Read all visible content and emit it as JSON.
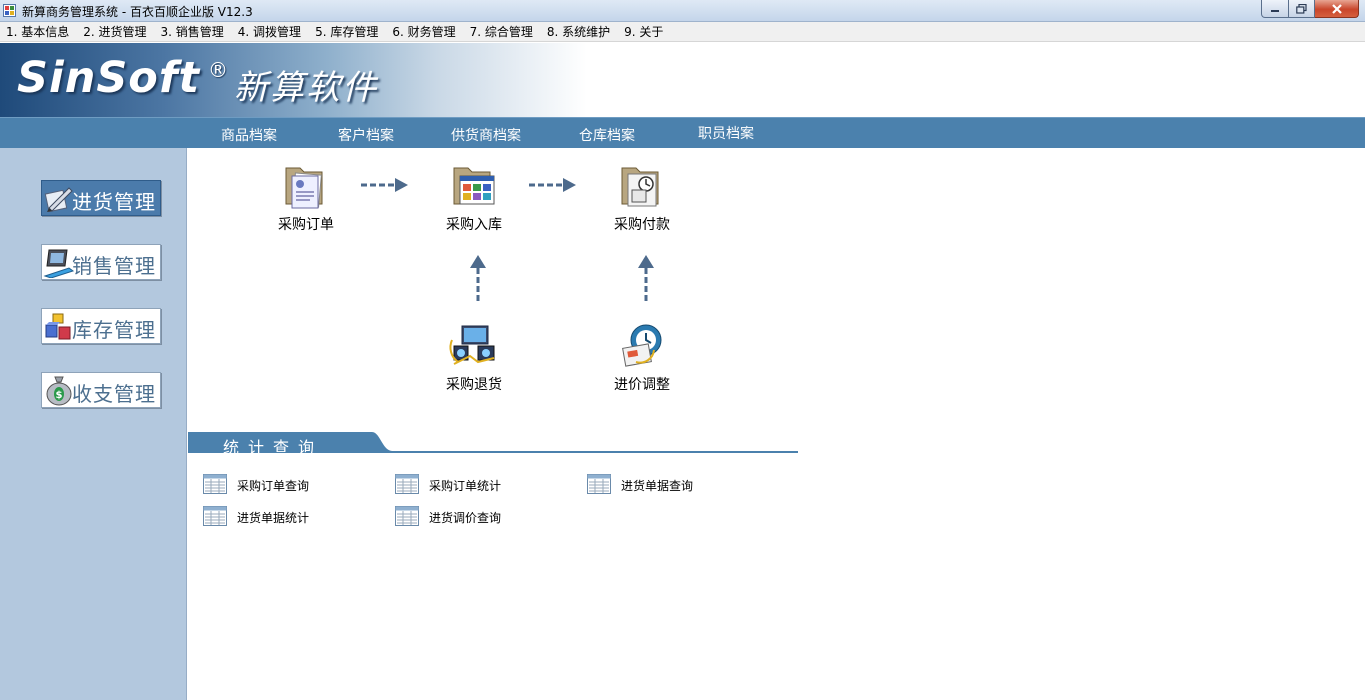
{
  "window": {
    "title": "新算商务管理系统 - 百衣百顺企业版 V12.3"
  },
  "menu": [
    "1. 基本信息",
    "2. 进货管理",
    "3. 销售管理",
    "4. 调拨管理",
    "5. 库存管理",
    "6. 财务管理",
    "7. 综合管理",
    "8. 系统维护",
    "9. 关于"
  ],
  "banner": {
    "logo_text": "SinSoft",
    "logo_reg": "®",
    "logo_cn": "新算软件"
  },
  "nav": [
    "商品档案",
    "客户档案",
    "供货商档案",
    "仓库档案",
    "职员档案"
  ],
  "sidebar": [
    {
      "label": "进货管理",
      "icon": "pen-paper-icon",
      "active": true
    },
    {
      "label": "销售管理",
      "icon": "computer-icon",
      "active": false
    },
    {
      "label": "库存管理",
      "icon": "boxes-icon",
      "active": false
    },
    {
      "label": "收支管理",
      "icon": "money-bag-icon",
      "active": false
    }
  ],
  "flow": {
    "order": {
      "label": "采购订单",
      "icon": "order-folder-icon"
    },
    "inbound": {
      "label": "采购入库",
      "icon": "inbound-folder-icon"
    },
    "payment": {
      "label": "采购付款",
      "icon": "payment-folder-icon"
    },
    "return": {
      "label": "采购退货",
      "icon": "return-icon"
    },
    "price_adjust": {
      "label": "进价调整",
      "icon": "price-adjust-icon"
    }
  },
  "stats": {
    "title": "统计查询",
    "reports": [
      "采购订单查询",
      "采购订单统计",
      "进货单据查询",
      "进货单据统计",
      "进货调价查询"
    ]
  },
  "colors": {
    "nav_bar": "#4b81ad",
    "sidebar": "#b3c8de",
    "active_button": "#4b7bab",
    "arrow": "#4d6a8c"
  }
}
